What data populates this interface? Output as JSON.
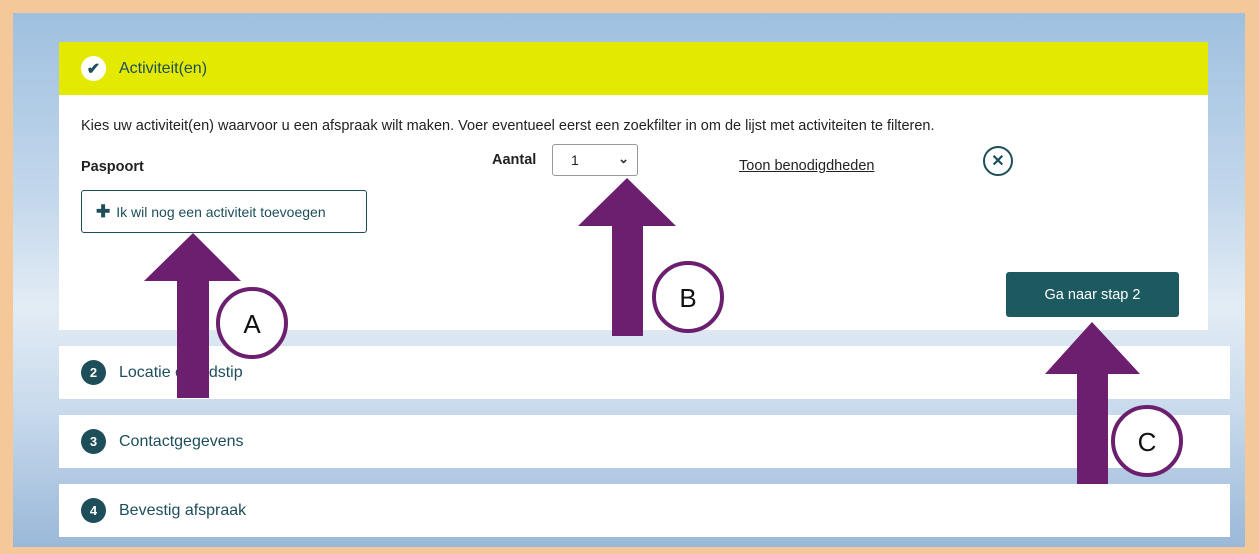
{
  "step1": {
    "title": "Activiteit(en)",
    "intro": "Kies uw activiteit(en) waarvoor u een afspraak wilt maken. Voer eventueel eerst een zoekfilter in om de lijst met activiteiten te filteren.",
    "activity_name": "Paspoort",
    "aantal_label": "Aantal",
    "aantal_value": "1",
    "toon_link": "Toon benodigdheden",
    "add_button": "Ik wil nog een activiteit toevoegen",
    "next_button": "Ga naar stap 2"
  },
  "steps": [
    {
      "number": "2",
      "title": "Locatie en tijdstip"
    },
    {
      "number": "3",
      "title": "Contactgegevens"
    },
    {
      "number": "4",
      "title": "Bevestig afspraak"
    }
  ],
  "annotations": {
    "a": "A",
    "b": "B",
    "c": "C"
  },
  "colors": {
    "accent_yellow": "#e3ea00",
    "primary_teal": "#1d5a60",
    "arrow_purple": "#6b1f6e",
    "frame_orange": "#f5c89a"
  }
}
